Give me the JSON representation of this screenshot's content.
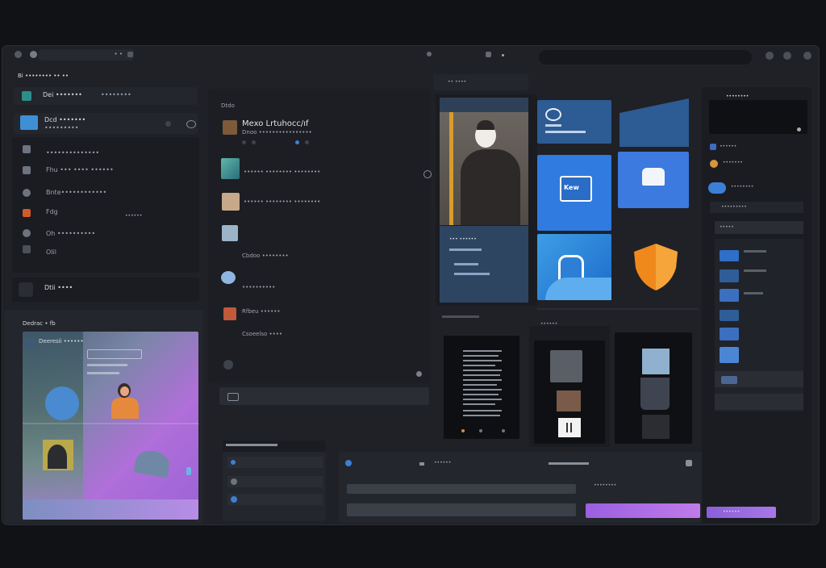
{
  "window": {
    "address_text": "• •",
    "title_left": "Bi •••••••• •• ••"
  },
  "left_list": {
    "items": [
      {
        "title": "Dei •••••••",
        "sub": "••••••••"
      },
      {
        "title": "Dcd •••••••",
        "sub": "•••••••••"
      },
      {
        "title": "••••••••••••••",
        "sub": ""
      },
      {
        "title": "Fhu ••• •••• ••••••",
        "sub": ""
      },
      {
        "title": "Bnte••••••••••••",
        "sub": ""
      },
      {
        "title": "Fdg",
        "sub": "••••••"
      },
      {
        "title": "Oh ••••••••••",
        "sub": ""
      },
      {
        "title": "Olil",
        "sub": ""
      }
    ],
    "footer_title": "Dtii ••••"
  },
  "preview_panel": {
    "title": "Dedrac • fb",
    "item": "Deeresii ••••••"
  },
  "feed": {
    "header": "Dtdo",
    "post_title": "Mexo Lrtuhocc/ıf",
    "post_sub": "Dnoo ••••••••••••••••",
    "rows": [
      "•••••• •••••••• ••••••••",
      "•••••• •••••••• ••••••••",
      "Cbdoo ••••••••",
      "••••••••••",
      "Rfbeu ••••••",
      "Csoeelso ••••"
    ]
  },
  "gallery": {
    "header": "•• ••••",
    "tile_text": "Kew",
    "card_title": "••• ••••••"
  },
  "right_sidebar": {
    "header": "••••••••",
    "items": [
      "••••••",
      "•••••••",
      "••••••••",
      "•••••",
      "••••••••"
    ],
    "section": "•••••••••",
    "button": "••••••"
  },
  "bottom_player": {
    "title": "••••••",
    "label": "••••••••"
  },
  "colors": {
    "accent_blue": "#2f7be0",
    "purple": "#a55fe0",
    "orange": "#f0891c"
  }
}
